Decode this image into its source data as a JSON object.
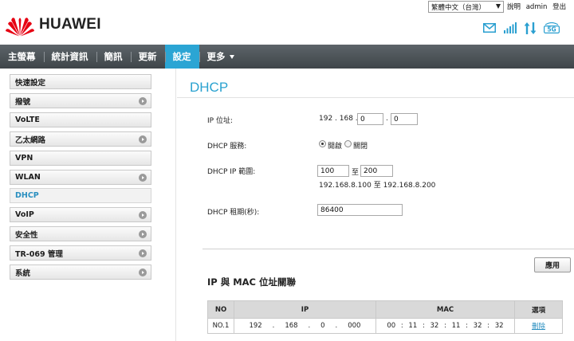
{
  "header": {
    "brand": "HUAWEI",
    "language": "繁體中文（台灣）",
    "links": [
      "說明",
      "admin",
      "登出"
    ]
  },
  "nav": [
    {
      "label": "主螢幕",
      "active": false
    },
    {
      "label": "統計資訊",
      "active": false
    },
    {
      "label": "簡訊",
      "active": false
    },
    {
      "label": "更新",
      "active": false
    },
    {
      "label": "設定",
      "active": true
    },
    {
      "label": "更多",
      "active": false
    }
  ],
  "sidebar": [
    {
      "label": "快速設定",
      "arrow": false
    },
    {
      "label": "撥號",
      "arrow": true
    },
    {
      "label": "VoLTE",
      "arrow": false
    },
    {
      "label": "乙太網路",
      "arrow": true
    },
    {
      "label": "VPN",
      "arrow": false
    },
    {
      "label": "WLAN",
      "arrow": true
    },
    {
      "label": "DHCP",
      "arrow": false,
      "active": true
    },
    {
      "label": "VoIP",
      "arrow": true
    },
    {
      "label": "安全性",
      "arrow": true
    },
    {
      "label": "TR-069 管理",
      "arrow": true
    },
    {
      "label": "系統",
      "arrow": true
    }
  ],
  "page": {
    "title": "DHCP",
    "ip_label": "IP 位址:",
    "ip_prefix": "192 . 168 .",
    "ip_octet3": "0",
    "ip_dot": ".",
    "ip_octet4": "0",
    "dhcp_service_label": "DHCP 服務:",
    "dhcp_on": "開啟",
    "dhcp_off": "關閉",
    "range_label": "DHCP IP 範圍:",
    "range_start": "100",
    "range_to": "至",
    "range_end": "200",
    "range_text": "192.168.8.100 至 192.168.8.200",
    "lease_label": "DHCP 租期(秒):",
    "lease_value": "86400",
    "apply_button": "應用",
    "binding_title": "IP 與 MAC 位址關聯"
  },
  "binding_table": {
    "headers": [
      "NO",
      "IP",
      "MAC",
      "選項"
    ],
    "rows": [
      {
        "no": "NO.1",
        "ip": [
          "192",
          ".",
          "168",
          ".",
          "0",
          ".",
          "000"
        ],
        "mac": [
          "00",
          ":",
          "11",
          ":",
          "32",
          ":",
          "11",
          ":",
          "32",
          ":",
          "32"
        ],
        "option": "刪除"
      }
    ]
  },
  "colors": {
    "accent": "#2ba5d4",
    "nav_bg": "#4b5257",
    "brand_red": "#e60012"
  },
  "icons": [
    "huawei-logo-icon",
    "mail-icon",
    "signal-icon",
    "data-arrows-icon",
    "5g-icon"
  ]
}
